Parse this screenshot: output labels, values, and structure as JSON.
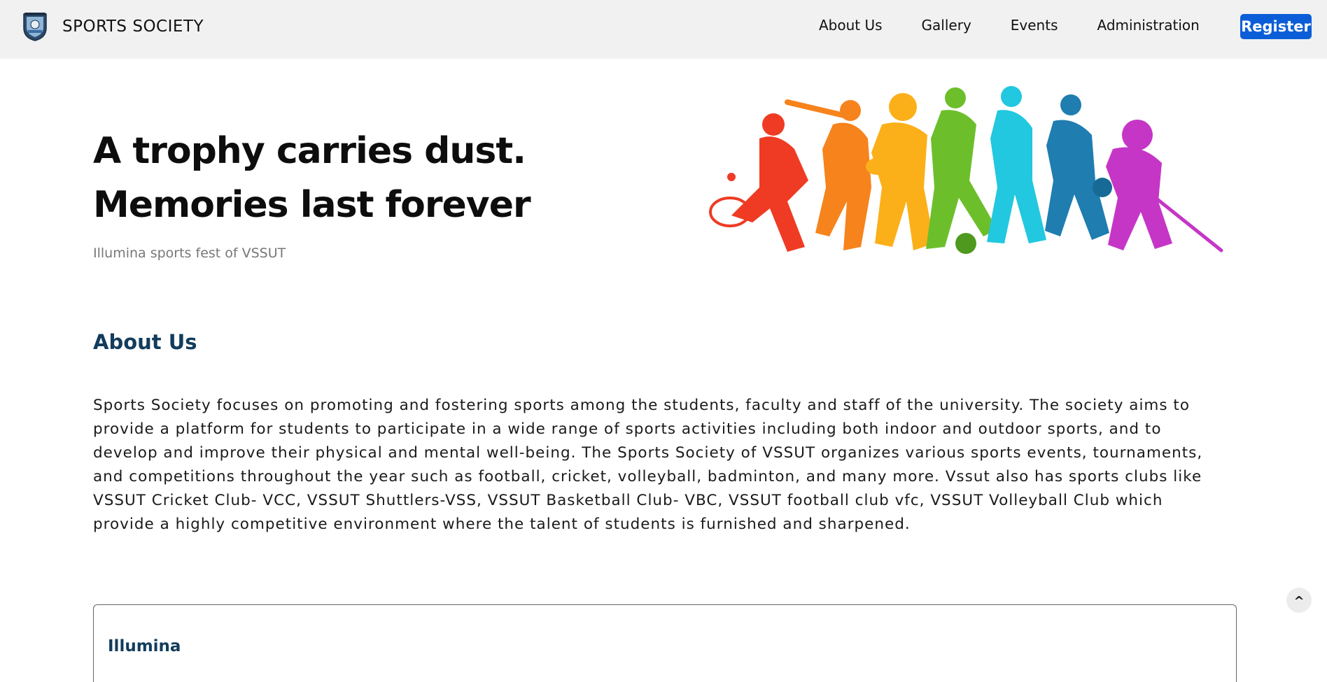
{
  "navbar": {
    "brand_name": "SPORTS SOCIETY",
    "links": [
      "About Us",
      "Gallery",
      "Events",
      "Administration"
    ],
    "register_label": "Register"
  },
  "hero": {
    "title_line1": "A trophy carries dust.",
    "title_line2": "Memories last forever",
    "subtitle": "Illumina sports fest of VSSUT"
  },
  "about": {
    "heading": "About Us",
    "body": "Sports Society focuses on promoting and fostering sports among the students, faculty and staff of the university. The society aims to provide a platform for students to participate in a wide range of sports activities including both indoor and outdoor sports, and to develop and improve their physical and mental well-being. The Sports Society of VSSUT organizes various sports events, tournaments, and competitions throughout the year such as football, cricket, volleyball, badminton, and many more. Vssut also has sports clubs like VSSUT Cricket Club- VCC, VSSUT Shuttlers-VSS, VSSUT Basketball Club- VBC, VSSUT football club vfc, VSSUT Volleyball Club which provide a highly competitive environment where the talent of students is furnished and sharpened."
  },
  "card": {
    "title": "Illumina"
  },
  "scroll_top_label": "^",
  "colors": {
    "nav_bg": "#f1f1f1",
    "accent": "#0b5ed7",
    "heading": "#123c5c"
  }
}
